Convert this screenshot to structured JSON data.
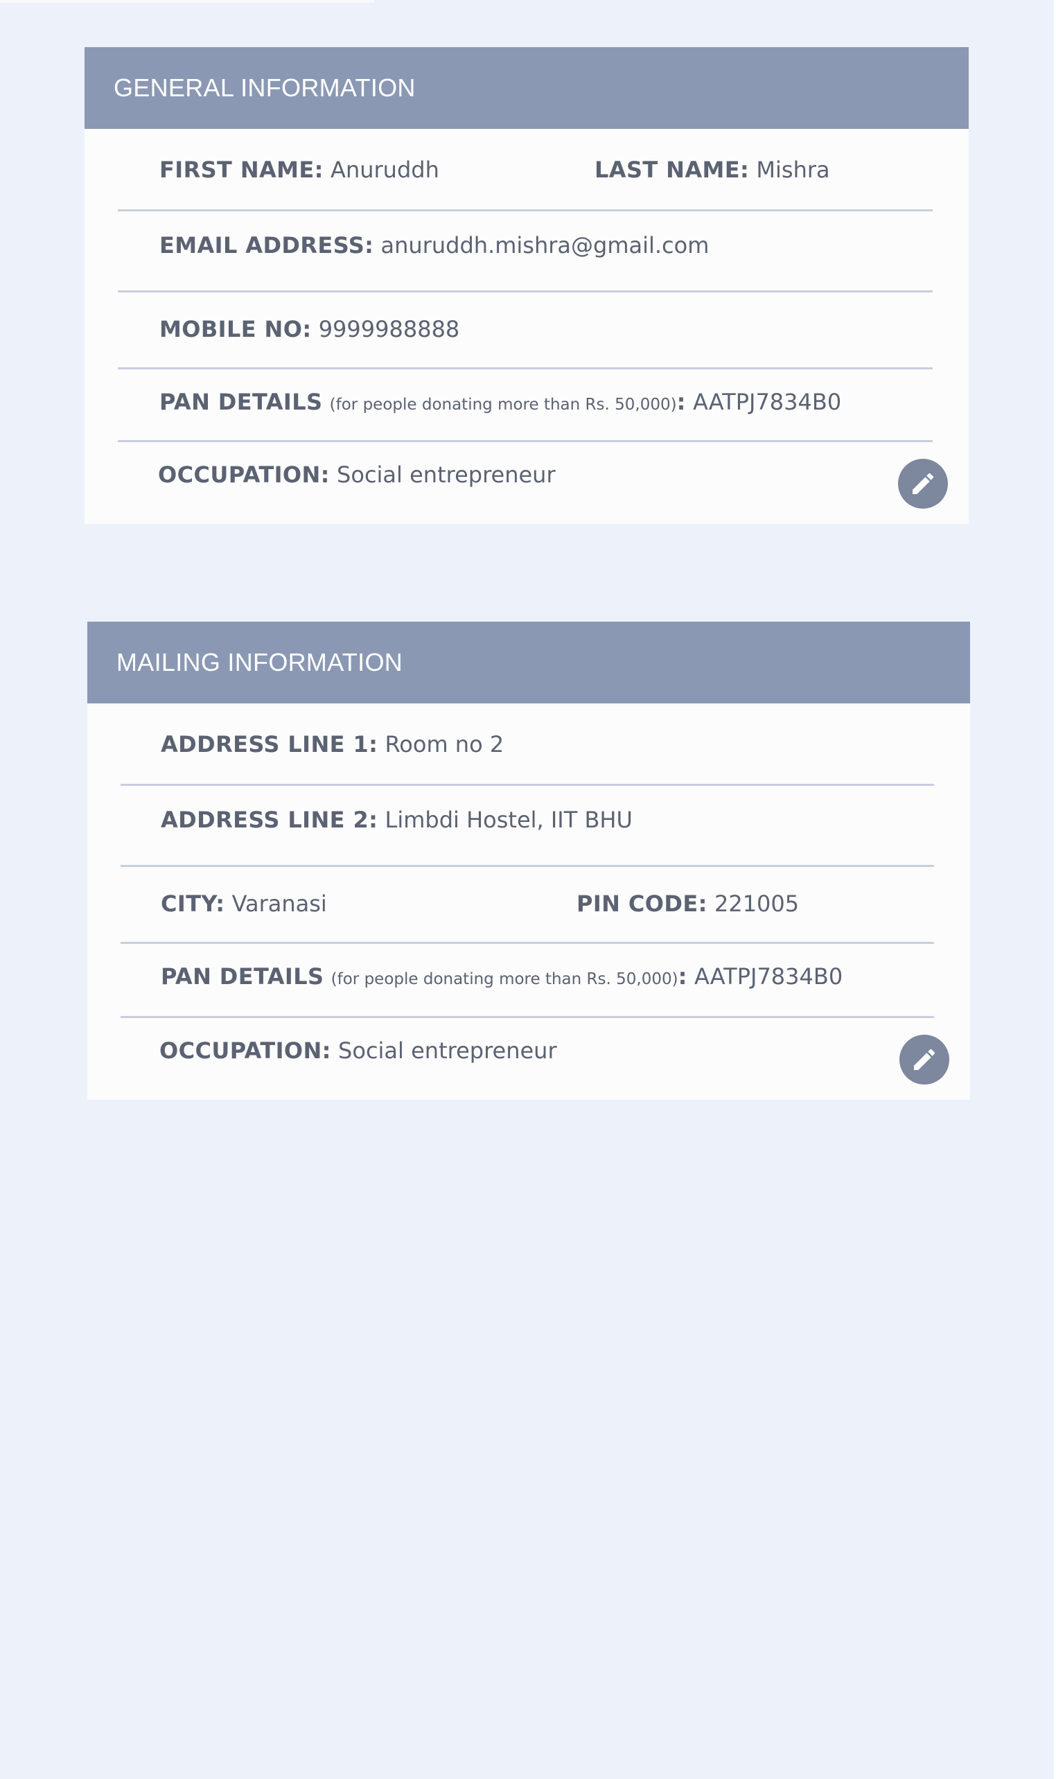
{
  "general": {
    "title": "GENERAL INFORMATION",
    "first_name_label": "FIRST NAME:",
    "first_name": "Anuruddh",
    "last_name_label": "LAST NAME:",
    "last_name": "Mishra",
    "email_label": "EMAIL ADDRESS:",
    "email": "anuruddh.mishra@gmail.com",
    "mobile_label": "MOBILE NO:",
    "mobile": "9999988888",
    "pan_label": "PAN DETAILS",
    "pan_note": "(for people donating more than Rs. 50,000)",
    "pan_colon": ":",
    "pan": "AATPJ7834B0",
    "occupation_label": "OCCUPATION:",
    "occupation": "Social entrepreneur",
    "edit_icon": "pencil-icon"
  },
  "mailing": {
    "title": "MAILING INFORMATION",
    "address1_label": "ADDRESS LINE 1:",
    "address1": "Room no 2",
    "address2_label": "ADDRESS LINE 2:",
    "address2": "Limbdi Hostel, IIT BHU",
    "city_label": "CITY:",
    "city": "Varanasi",
    "pin_label": "PIN CODE:",
    "pin": "221005",
    "pan_label": "PAN DETAILS",
    "pan_note": "(for people donating more than Rs. 50,000)",
    "pan_colon": ":",
    "pan": "AATPJ7834B0",
    "occupation_label": "OCCUPATION:",
    "occupation": "Social entrepreneur",
    "edit_icon": "pencil-icon"
  },
  "colors": {
    "page_background": "#edf2fa",
    "header_background": "#8a98b3",
    "card_background": "#fcfcfc",
    "divider": "#c8cedd",
    "text": "#5b6272",
    "edit_button": "#7d879e"
  }
}
